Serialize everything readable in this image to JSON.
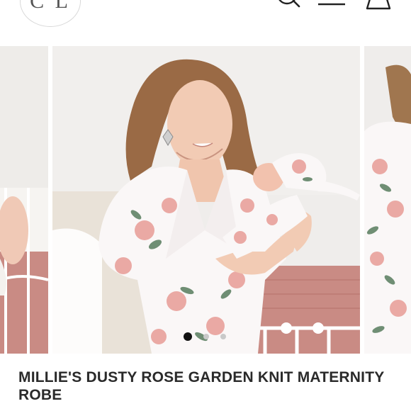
{
  "header": {
    "logo_text": "C L",
    "icons": [
      "search-icon",
      "menu-icon",
      "bag-icon"
    ]
  },
  "carousel": {
    "slide_count": 3,
    "active_index": 0
  },
  "product": {
    "title": "MILLIE'S DUSTY ROSE GARDEN KNIT MATERNITY ROBE"
  },
  "colors": {
    "accent": "#c27d76",
    "wall": "#efedeb",
    "blanket": "#c98b84",
    "floral_pink": "#eaa9a4",
    "floral_green": "#6f8e74"
  }
}
